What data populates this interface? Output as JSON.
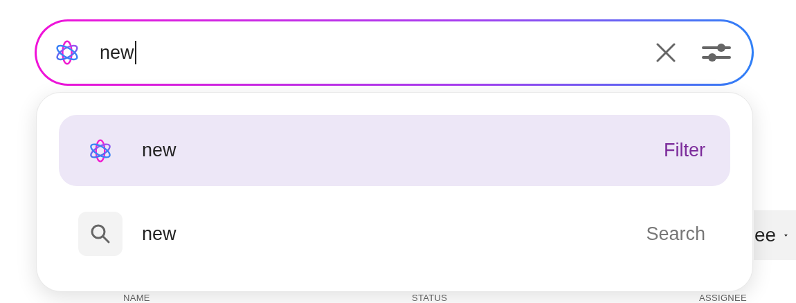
{
  "search": {
    "value": "new"
  },
  "suggestions": [
    {
      "kind": "filter",
      "text": "new",
      "action": "Filter",
      "selected": true
    },
    {
      "kind": "search",
      "text": "new",
      "action": "Search",
      "selected": false
    }
  ],
  "toolbar": {
    "dropdown_label": "ee"
  },
  "table": {
    "columns": [
      "NAME",
      "STATUS",
      "ASSIGNEE"
    ]
  }
}
